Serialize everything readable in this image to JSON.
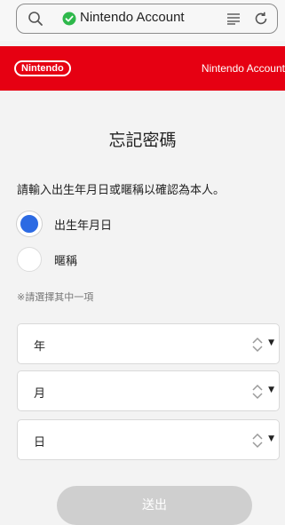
{
  "browser": {
    "url_text": "Nintendo Account",
    "icons": [
      "search-icon",
      "shield-check-icon",
      "reader-icon",
      "reload-icon"
    ]
  },
  "header": {
    "logo_text": "Nintendo",
    "account_label": "Nintendo Account",
    "brand_color": "#e60012"
  },
  "page": {
    "title": "忘記密碼",
    "instruction": "請輸入出生年月日或暱稱以確認為本人。",
    "options": [
      {
        "label": "出生年月日",
        "selected": true
      },
      {
        "label": "暱稱",
        "selected": false
      }
    ],
    "note": "※請選擇其中一項",
    "selects": {
      "year": "年",
      "month": "月",
      "day": "日"
    },
    "submit_label": "送出",
    "accent_color": "#2c6ae3"
  }
}
